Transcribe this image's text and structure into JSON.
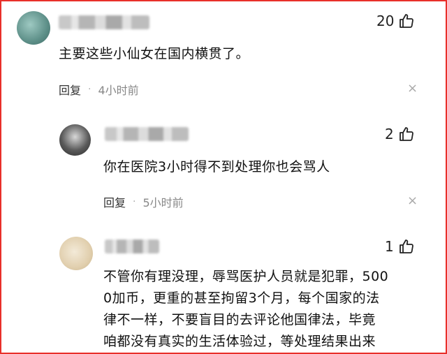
{
  "comments": [
    {
      "likes": "20",
      "text": "主要这些小仙女在国内横贯了。",
      "reply_label": "回复",
      "dot": "·",
      "time": "4小时前",
      "close": "×"
    },
    {
      "likes": "2",
      "text": "你在医院3小时得不到处理你也会骂人",
      "reply_label": "回复",
      "dot": "·",
      "time": "5小时前",
      "close": "×"
    },
    {
      "likes": "1",
      "text_lines": [
        "不管你有理没理，辱骂医护人员就是犯罪，500",
        "0加币，更重的甚至拘留3个月，每个国家的法",
        "律不一样，不要盲目的去评论他国律法，毕竟",
        "咱都没有真实的生活体验过，等处理结果出来"
      ]
    }
  ],
  "icons": {
    "like": "thumbs-up-icon",
    "close": "close-icon"
  },
  "colors": {
    "frame": "#e8302a"
  }
}
